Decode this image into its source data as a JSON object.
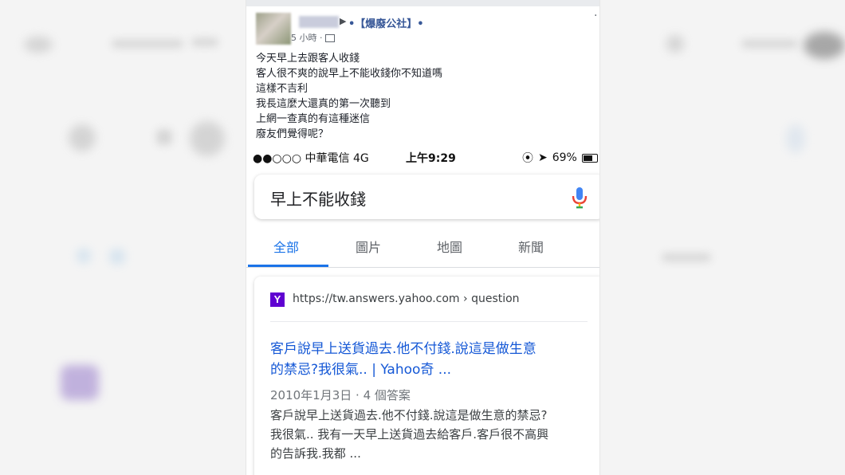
{
  "post": {
    "group_name": "•【爆廢公社】•",
    "meta": "5 小時 · ",
    "lines": [
      "今天早上去跟客人收錢",
      "客人很不爽的說早上不能收錢你不知道嗎",
      "這樣不吉利",
      "我長這麼大還真的第一次聽到",
      "上網一查真的有這種迷信",
      "廢友們覺得呢？"
    ]
  },
  "phone": {
    "signal": "●●○○○ 中華電信  4G",
    "time": "上午9:29",
    "battery": "69%",
    "search_query": "早上不能收錢",
    "tabs": [
      "全部",
      "圖片",
      "地圖",
      "新聞"
    ],
    "active_tab": 0,
    "result": {
      "favicon": "Y",
      "url": "https://tw.answers.yahoo.com › question",
      "title_lines": [
        "客戶說早上送貨過去.他不付錢.說這是做生意",
        "的禁忌?我很氣.. | Yahoo奇 ..."
      ],
      "date": "2010年1月3日 · 4 個答案",
      "snippet_lines": [
        "客戶說早上送貨過去.他不付錢.說這是做生意的禁忌?",
        "我很氣.. 我有一天早上送貨過去給客戶.客戶很不高興",
        "的告訴我.我都 ..."
      ]
    }
  },
  "colors": {
    "link_blue": "#1a73e8",
    "facebook_blue": "#385898",
    "yahoo_purple": "#5f01d1"
  }
}
